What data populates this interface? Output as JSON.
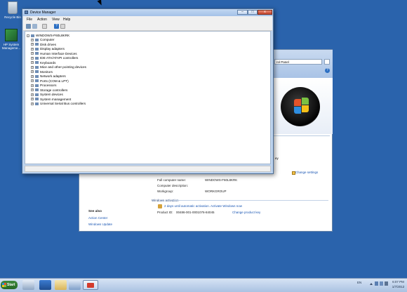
{
  "desktop": {
    "icons": [
      {
        "label": "Recycle Bin",
        "icon": "recycle-bin-icon"
      },
      {
        "label": "HP System Manageme...",
        "icon": "hp-system-management-icon"
      }
    ]
  },
  "system_window": {
    "address_text": "rol Panel",
    "product_key_fragment": "ey",
    "change_settings": "Change settings",
    "rows": [
      {
        "label": "Full computer name:",
        "value": "WINDOWS-F60L8KRK"
      },
      {
        "label": "Computer description:",
        "value": ""
      },
      {
        "label": "Workgroup:",
        "value": "WORKGROUP"
      }
    ],
    "activation_title": "Windows activation",
    "activation_text": "2 days until automatic activation. Activate Windows now",
    "product_id_label": "Product ID:",
    "product_id_value": "00486-001-0001076-84045",
    "change_product_key": "Change product key",
    "see_also": "See also",
    "see_also_links": [
      "Action Center",
      "Windows Update"
    ]
  },
  "device_manager": {
    "title": "Device Manager",
    "menu": [
      "File",
      "Action",
      "View",
      "Help"
    ],
    "window_buttons": {
      "minimize": "–",
      "maximize": "□",
      "close": "x"
    },
    "help_glyph": "?",
    "tree_root": "WINDOWS-F60L8KRK",
    "tree_items": [
      "Computer",
      "Disk drives",
      "Display adapters",
      "Human Interface Devices",
      "IDE ATA/ATAPI controllers",
      "Keyboards",
      "Mice and other pointing devices",
      "Monitors",
      "Network adapters",
      "Ports (COM & LPT)",
      "Processors",
      "Storage controllers",
      "System devices",
      "System management",
      "Universal Serial Bus controllers"
    ]
  },
  "taskbar": {
    "start_label": "Start",
    "language": "EN",
    "time": "6:07 PM",
    "date": "1/7/2012"
  }
}
